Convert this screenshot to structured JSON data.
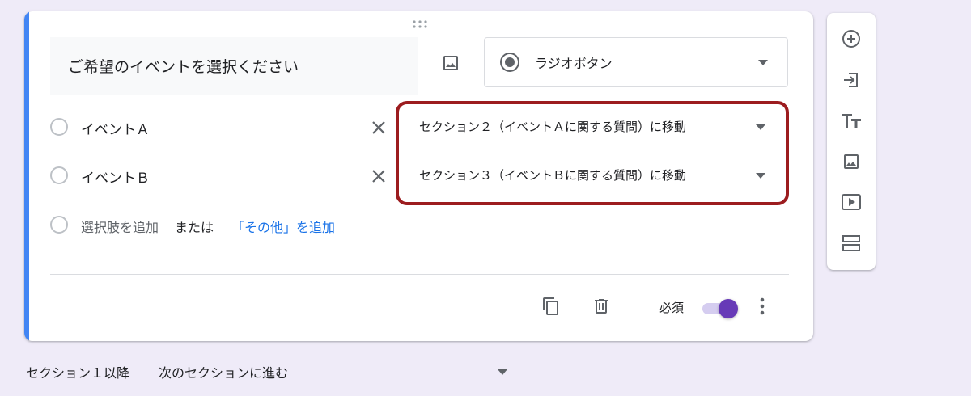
{
  "question": {
    "title": "ご希望のイベントを選択ください",
    "type_label": "ラジオボタン",
    "options": [
      {
        "label": "イベントＡ",
        "goto": "セクション２（イベントＡに関する質問）に移動"
      },
      {
        "label": "イベントＢ",
        "goto": "セクション３（イベントＢに関する質問）に移動"
      }
    ],
    "add_option": "選択肢を追加",
    "or": "または",
    "add_other": "「その他」を追加",
    "required_label": "必須",
    "required": true
  },
  "after_section": {
    "label": "セクション１以降",
    "value": "次のセクションに進む"
  },
  "colors": {
    "accent": "#4285f4",
    "toggle": "#673ab7",
    "highlight": "#9c1c1f",
    "link": "#1a73e8"
  },
  "icons": {
    "side_toolbar": [
      "add-circle-icon",
      "import-icon",
      "title-icon",
      "image-icon",
      "video-icon",
      "section-icon"
    ],
    "footer": [
      "duplicate-icon",
      "delete-icon",
      "more-vert-icon"
    ]
  }
}
